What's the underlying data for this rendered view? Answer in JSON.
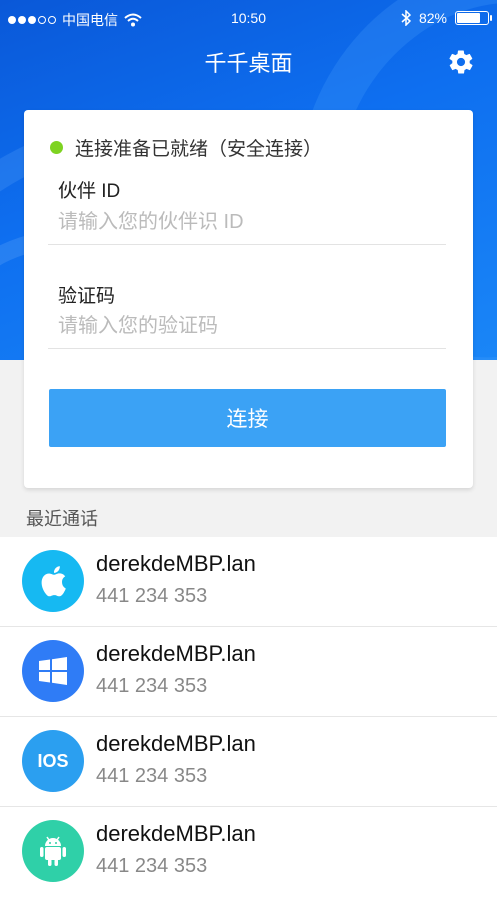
{
  "status_bar": {
    "carrier": "中国电信",
    "time": "10:50",
    "battery_text": "82%",
    "battery_level": 0.82,
    "icons": [
      "signal-dots-icon",
      "wifi-icon",
      "bluetooth-icon",
      "battery-icon"
    ]
  },
  "header": {
    "title": "千千桌面",
    "settings_icon": "gear-icon"
  },
  "connection_card": {
    "status_text": "连接准备已就绪（安全连接）",
    "status_color": "#7ed321",
    "partner_id_label": "伙伴 ID",
    "partner_id_placeholder": "请输入您的伙伴识 ID",
    "verify_code_label": "验证码",
    "verify_code_placeholder": "请输入您的验证码",
    "connect_button": "连接",
    "accent": "#3ba2f5"
  },
  "recent": {
    "title": "最近通话",
    "items": [
      {
        "name": "derekdeMBP.lan",
        "id": "441 234 353",
        "icon": "apple-icon",
        "color": "#16b9f2"
      },
      {
        "name": "derekdeMBP.lan",
        "id": "441 234 353",
        "icon": "windows-icon",
        "color": "#2f7cf6"
      },
      {
        "name": "derekdeMBP.lan",
        "id": "441 234 353",
        "icon": "ios-icon",
        "icon_text": "IOS",
        "color": "#2b9ff0"
      },
      {
        "name": "derekdeMBP.lan",
        "id": "441 234 353",
        "icon": "android-icon",
        "color": "#2fd0a8"
      }
    ]
  }
}
